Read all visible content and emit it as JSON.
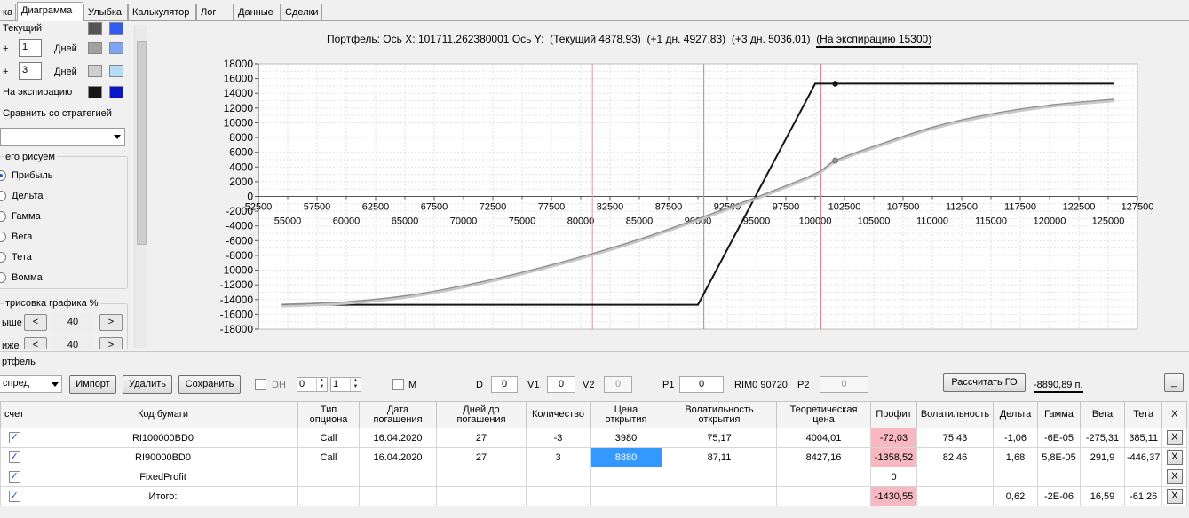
{
  "tabs": [
    "ка",
    "Диаграмма",
    "Улыбка",
    "Калькулятор",
    "Лог",
    "Данные",
    "Сделки"
  ],
  "left": {
    "current_label": "Текущий",
    "plus": "+",
    "days_label": "Дней",
    "day1_value": "1",
    "day2_value": "3",
    "expiry_label": "На экспирацию",
    "compare_label": "Сравнить со стратегией",
    "draw_group_label": "его рисуем",
    "radios": [
      "Прибыль",
      "Дельта",
      "Гамма",
      "Вега",
      "Тета",
      "Вомма"
    ],
    "selected_radio": "Прибыль",
    "redraw_label": "трисовка графика %",
    "upper_label": "ыше",
    "upper_value": "40",
    "lower_label": "иже",
    "lower_value": "40",
    "btn_left": "<",
    "btn_right": ">",
    "colors": {
      "current": [
        "#555555",
        "#2f5cf0"
      ],
      "day1": [
        "#a0a0a0",
        "#7aa6f5"
      ],
      "day2": [
        "#cfcfcf",
        "#b3dcf5"
      ],
      "expiry": [
        "#151515",
        "#0b15c8"
      ]
    }
  },
  "chart_title": {
    "portfolio": "Портфель:",
    "axis_x_label": "Ось X:",
    "axis_x_value": "101711,262380001",
    "axis_y_label": "Ось Y:",
    "current": "(Текущий 4878,93)",
    "plus1": "(+1 дн. 4927,83)",
    "plus3": "(+3 дн. 5036,01)",
    "expiry": "(На экспирацию 15300)"
  },
  "chart_data": {
    "type": "line",
    "xlim": [
      52500,
      127500
    ],
    "ylim": [
      -18000,
      18000
    ],
    "x_ticks_upper": [
      52500,
      57500,
      62500,
      67500,
      72500,
      77500,
      82500,
      87500,
      92500,
      97500,
      102500,
      107500,
      112500,
      117500,
      122500,
      127500
    ],
    "x_ticks_lower": [
      55000,
      60000,
      65000,
      70000,
      75000,
      80000,
      85000,
      90000,
      95000,
      100000,
      105000,
      110000,
      115000,
      120000,
      125000
    ],
    "y_ticks": [
      18000,
      16000,
      14000,
      12000,
      10000,
      8000,
      6000,
      4000,
      2000,
      0,
      -2000,
      -4000,
      -6000,
      -8000,
      -10000,
      -12000,
      -14000,
      -16000,
      -18000
    ],
    "grid": true,
    "vlines": [
      {
        "x": 81000,
        "color": "#f0a0a8"
      },
      {
        "x": 90500,
        "color": "#9aa8a8"
      },
      {
        "x": 100500,
        "color": "#f08090"
      }
    ],
    "series": [
      {
        "color": "#151515",
        "x": [
          54500,
          90000,
          100000,
          125500
        ],
        "y": [
          -14700,
          -14700,
          15300,
          15300
        ]
      },
      {
        "color": "#8f8f8f",
        "x": [
          54500,
          60000,
          65000,
          70000,
          75000,
          80000,
          85000,
          90000,
          95000,
          100000,
          101711,
          105000,
          110000,
          115000,
          120000,
          125500
        ],
        "y": [
          -14650,
          -14300,
          -13500,
          -12100,
          -10300,
          -8200,
          -5800,
          -3000,
          -100,
          3100,
          4878,
          6800,
          9400,
          11200,
          12400,
          13200
        ]
      }
    ],
    "markers": [
      {
        "x": 101711,
        "y": 15300
      },
      {
        "x": 101711,
        "y": 4878
      }
    ]
  },
  "bottom": {
    "group_label": "ртфель",
    "strategy_value": "спред",
    "import_btn": "Импорт",
    "delete_btn": "Удалить",
    "save_btn": "Сохранить",
    "dh_label": "DH",
    "spin1": "0",
    "spin2": "1",
    "m_label": "M",
    "d_label": "D",
    "d_value": "0",
    "v1_label": "V1",
    "v1_value": "0",
    "v2_label": "V2",
    "v2_value": "0",
    "p1_label": "P1",
    "p1_value": "0",
    "rim_label": "RIM0 90720",
    "p2_label": "P2",
    "p2_value": "0",
    "calc_go_btn": "Рассчитать ГО",
    "go_value": "-8890,89 п.",
    "minimize_btn": "_"
  },
  "table": {
    "headers": [
      "счет",
      "Код бумаги",
      "Тип опциона",
      "Дата погашения",
      "Дней до погашения",
      "Количество",
      "Цена открытия",
      "Волатильность открытия",
      "Теоретическая цена",
      "Профит",
      "Волатильность",
      "Дельта",
      "Гамма",
      "Вега",
      "Тета",
      "X"
    ],
    "rows": [
      [
        "",
        "RI100000BD0",
        "Call",
        "16.04.2020",
        "27",
        "-3",
        "3980",
        "75,17",
        "4004,01",
        "-72,03",
        "75,43",
        "-1,06",
        "-6E-05",
        "-275,31",
        "385,11",
        "X"
      ],
      [
        "",
        "RI90000BD0",
        "Call",
        "16.04.2020",
        "27",
        "3",
        "8880",
        "87,11",
        "8427,16",
        "-1358,52",
        "82,46",
        "1,68",
        "5,8E-05",
        "291,9",
        "-446,37",
        "X"
      ],
      [
        "",
        "FixedProfit",
        "",
        "",
        "",
        "",
        "",
        "",
        "",
        "0",
        "",
        "",
        "",
        "",
        "",
        "X"
      ],
      [
        "",
        "Итого:",
        "",
        "",
        "",
        "",
        "",
        "",
        "",
        "-1430,55",
        "",
        "0,62",
        "-2E-06",
        "16,59",
        "-61,26",
        "X"
      ]
    ]
  }
}
